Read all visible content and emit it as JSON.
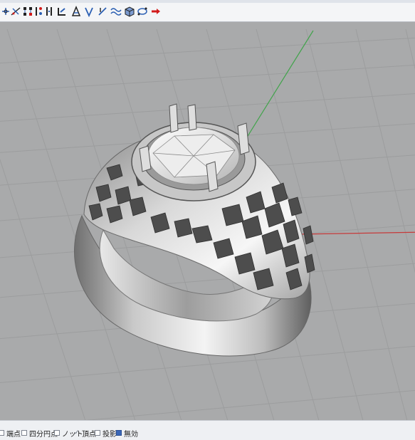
{
  "toolbar": {
    "tools": [
      {
        "icon": "move-icon"
      },
      {
        "icon": "gumball-icon"
      },
      {
        "icon": "control-points-icon"
      },
      {
        "icon": "edit-points-icon"
      },
      {
        "icon": "split-icon"
      },
      {
        "icon": "join-edge-icon"
      },
      {
        "icon": "trim-icon"
      },
      {
        "icon": "extend-icon"
      },
      {
        "icon": "curve-icon"
      },
      {
        "icon": "wave-curve-icon"
      },
      {
        "icon": "solid-box-icon"
      },
      {
        "icon": "mesh-icon"
      },
      {
        "icon": "flow-arrow-icon"
      }
    ],
    "colors": {
      "accent": "#d21b1b",
      "blue": "#2b5fb3"
    }
  },
  "viewport": {
    "background": "#a9aaab",
    "grid_color": "#9a9b9c",
    "x_axis_color": "#c63a3a",
    "y_axis_color": "#41a34b",
    "object": "ring"
  },
  "statusbar": {
    "snaps": [
      {
        "label": "端点",
        "checked": false
      },
      {
        "label": "四分円点",
        "checked": false
      },
      {
        "label": "ノット",
        "checked": true
      },
      {
        "label": "頂点",
        "checked": false
      },
      {
        "label": "投影",
        "checked": false
      },
      {
        "label": "無効",
        "checked": true
      }
    ]
  }
}
